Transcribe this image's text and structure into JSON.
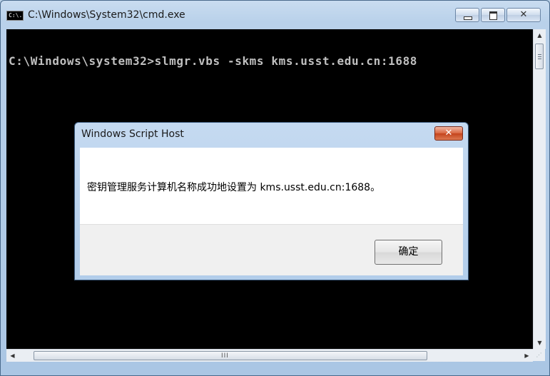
{
  "window": {
    "title": "C:\\Windows\\System32\\cmd.exe",
    "icon_text": "C:\\."
  },
  "console": {
    "line": "C:\\Windows\\system32>slmgr.vbs -skms kms.usst.edu.cn:1688"
  },
  "dialog": {
    "title": "Windows Script Host",
    "message": "密钥管理服务计算机名称成功地设置为 kms.usst.edu.cn:1688。",
    "ok_label": "确定",
    "close_glyph": "✕"
  },
  "controls": {
    "min_icon": "minimize-icon",
    "max_icon": "maximize-icon",
    "close_glyph": "✕",
    "scroll_up": "▲",
    "scroll_down": "▼",
    "scroll_left": "◀",
    "scroll_right": "▶",
    "h_grip": "III"
  }
}
